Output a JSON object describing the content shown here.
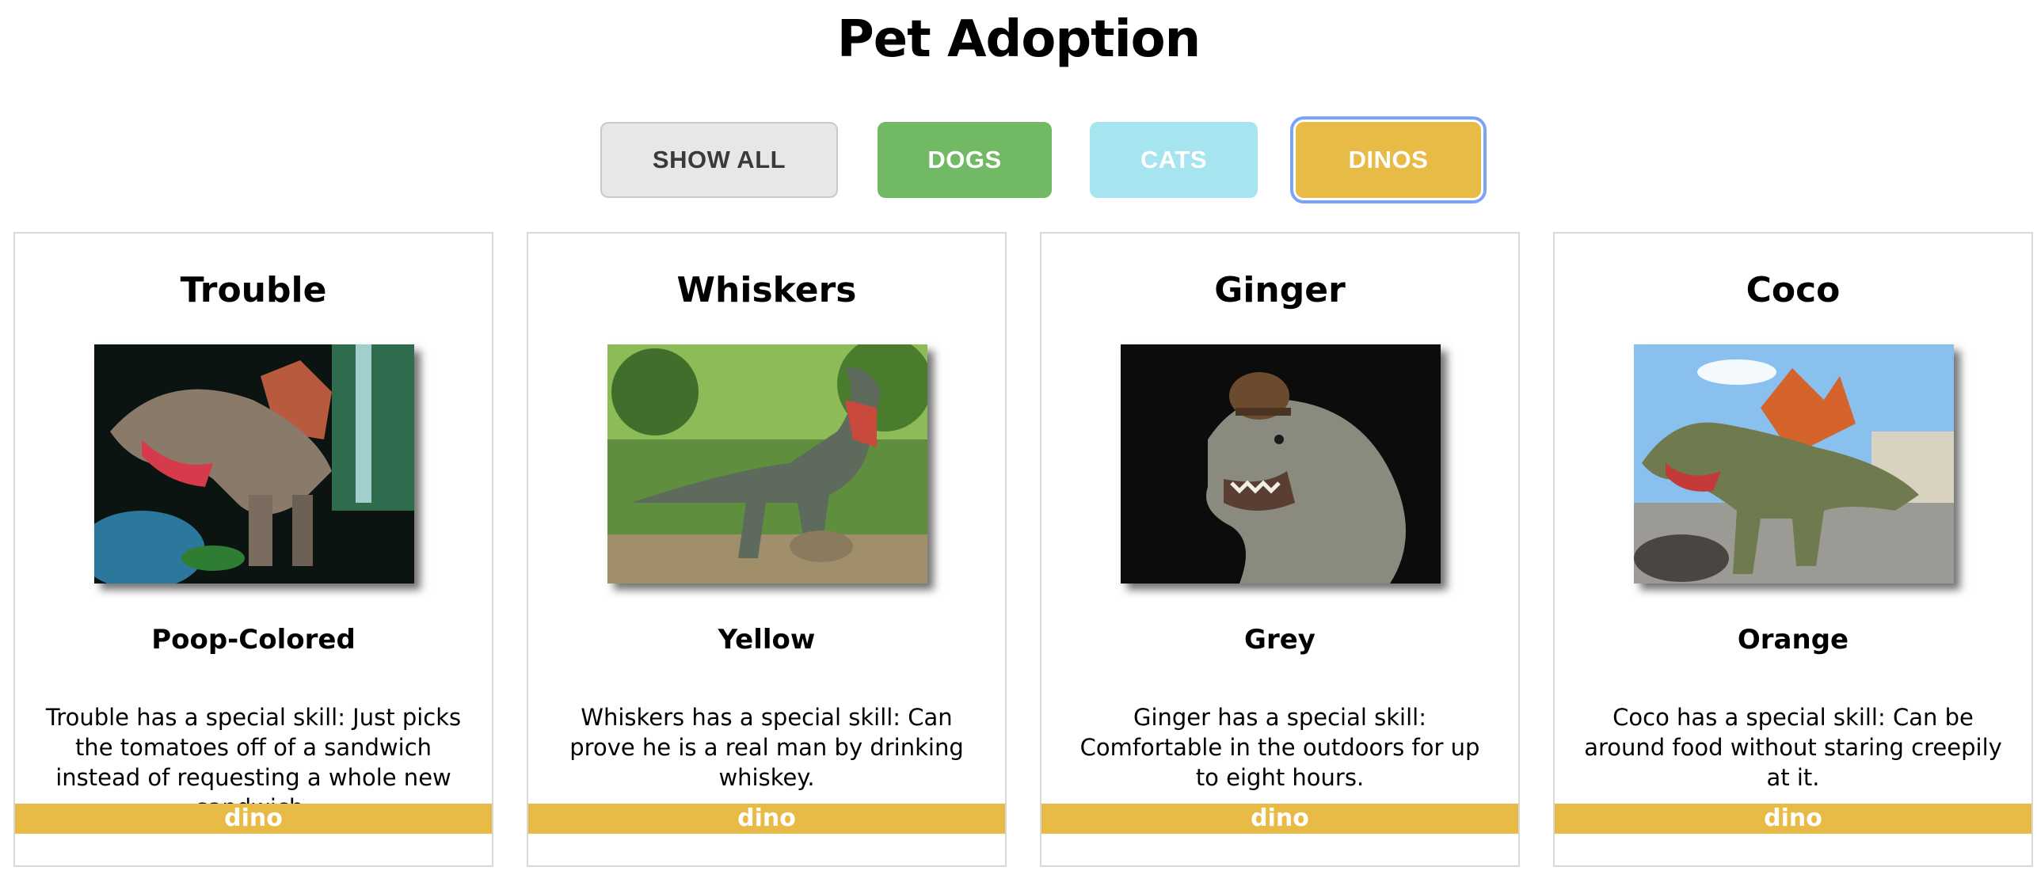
{
  "page": {
    "title": "Pet Adoption"
  },
  "filters": [
    {
      "label": "SHOW ALL"
    },
    {
      "label": "DOGS"
    },
    {
      "label": "CATS"
    },
    {
      "label": "DINOS"
    }
  ],
  "active_filter": "DINOS",
  "colors": {
    "dino": "#e8bb47",
    "dogs": "#72b966",
    "cats": "#a6e5ef",
    "show_all": "#e8e7e6",
    "focus_ring": "#7aa4f5"
  },
  "pets": [
    {
      "name": "Trouble",
      "color": "Poop-Colored",
      "description": "Trouble has a special skill: Just picks the tomatoes off of a sandwich instead of requesting a whole new sandwich.",
      "type": "dino",
      "image": "spinosaurus-cave-photo"
    },
    {
      "name": "Whiskers",
      "color": "Yellow",
      "description": "Whiskers has a special skill: Can prove he is a real man by drinking whiskey.",
      "type": "dino",
      "image": "t-rex-forest-photo"
    },
    {
      "name": "Ginger",
      "color": "Grey",
      "description": "Ginger has a special skill: Comfortable in the outdoors for up to eight hours.",
      "type": "dino",
      "image": "t-rex-with-hat-photo"
    },
    {
      "name": "Coco",
      "color": "Orange",
      "description": "Coco has a special skill: Can be around food without staring creepily at it.",
      "type": "dino",
      "image": "dimetrodon-outdoor-photo"
    }
  ]
}
